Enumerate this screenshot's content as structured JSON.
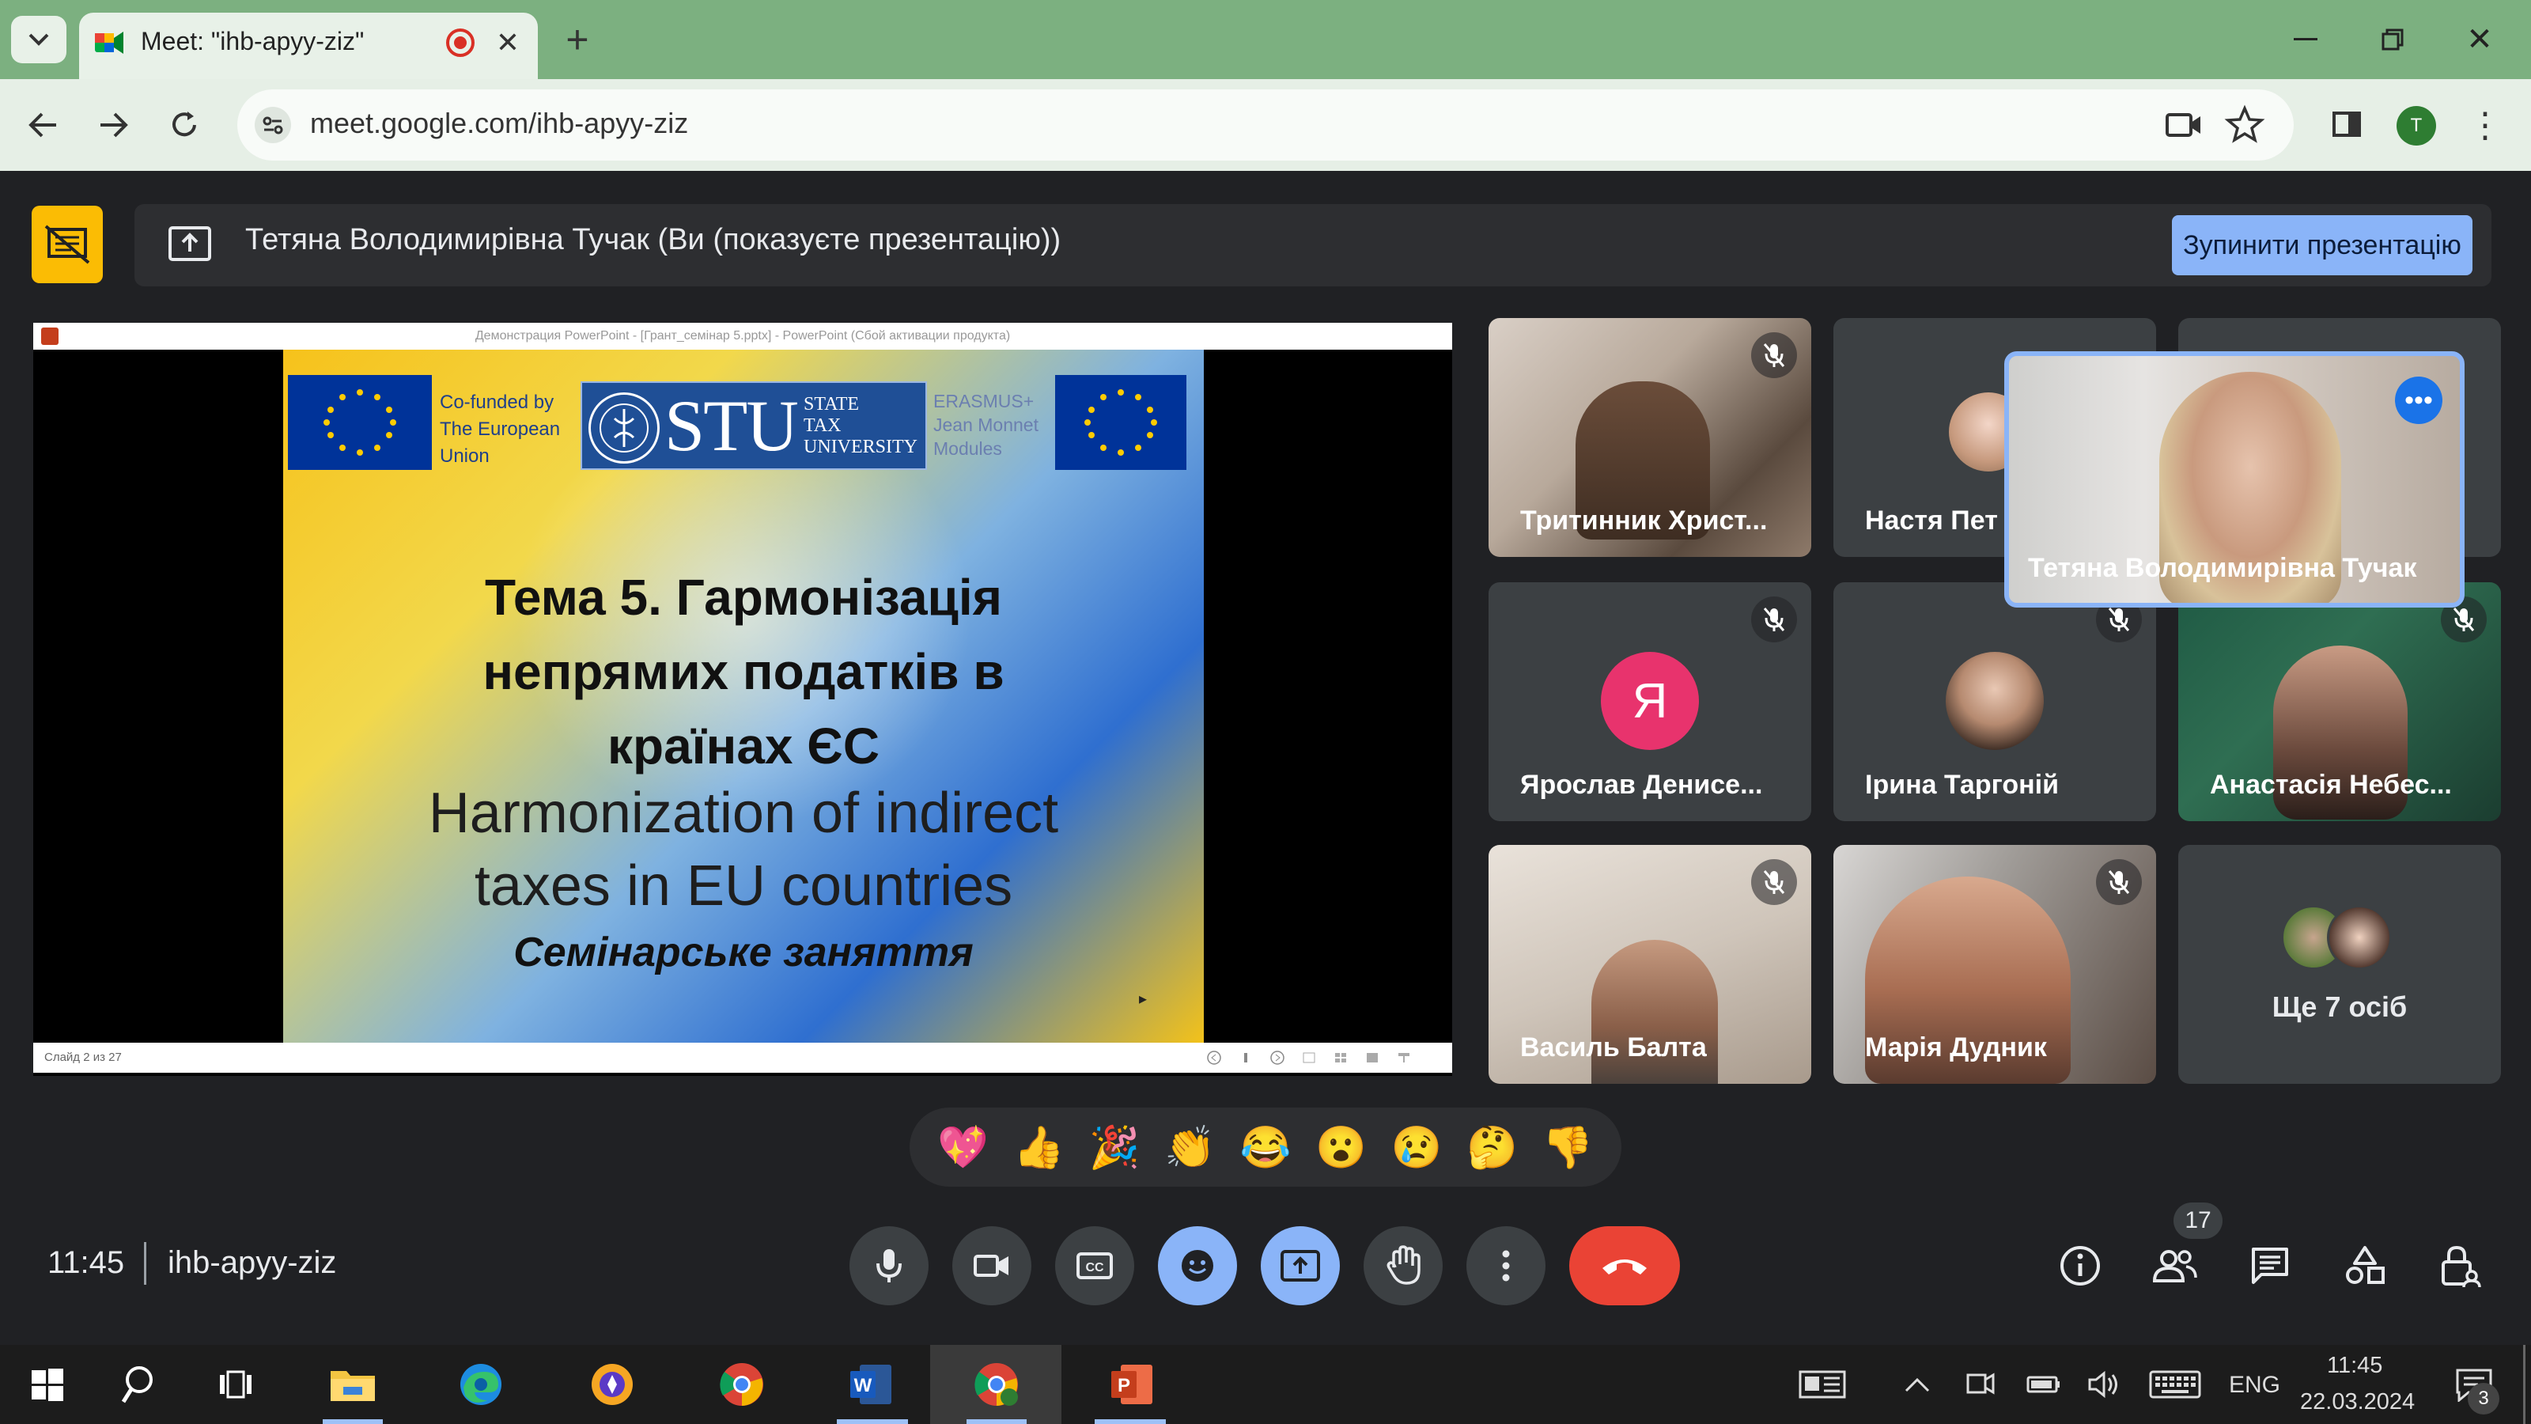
{
  "browser": {
    "tab_title": "Meet: \"ihb-apyy-ziz\"",
    "new_tab": "+",
    "url": "meet.google.com/ihb-apyy-ziz",
    "profile_initial": "T"
  },
  "meet": {
    "present_banner": "Тетяна Володимирівна Тучак (Ви (показуєте презентацію))",
    "stop_presenting": "Зупинити презентацію",
    "time": "11:45",
    "meeting_code": "ihb-apyy-ziz",
    "participant_count": "17",
    "more_people_label": "Ще 7 осіб"
  },
  "presentation": {
    "window_title": "Демонстрация PowerPoint - [Грант_семінар 5.pptx] - PowerPoint (Сбой активации продукта)",
    "status": "Слайд 2 из 27",
    "cofunded": [
      "Co-funded by",
      "The European",
      "Union"
    ],
    "stu_big": "STU",
    "stu_small": [
      "STATE",
      "TAX",
      "UNIVERSITY"
    ],
    "erasmus": [
      "ERASMUS+",
      "Jean Monnet",
      "Modules"
    ],
    "title_lines": [
      "Тема 5. Гармонізація",
      "непрямих податків в",
      "країнах ЄС"
    ],
    "subtitle_lines": [
      "Harmonization of indirect",
      "taxes in EU countries"
    ],
    "seminar": "Семінарське заняття"
  },
  "participants": [
    {
      "name": "Тритинник Христ...",
      "muted": true
    },
    {
      "name": "Настя Пет",
      "muted": false
    },
    {
      "name": "Тетяна Володимирівна Тучак",
      "muted": false
    },
    {
      "name": "Ярослав Денисе...",
      "muted": true,
      "avatar_letter": "Я",
      "avatar_color": "#e8336d"
    },
    {
      "name": "Ірина Таргоній",
      "muted": true
    },
    {
      "name": "Анастасія Небес...",
      "muted": true
    },
    {
      "name": "Василь Балта",
      "muted": true
    },
    {
      "name": "Марія Дудник",
      "muted": true
    }
  ],
  "reactions": [
    "💖",
    "👍",
    "🎉",
    "👏",
    "😂",
    "😮",
    "😢",
    "🤔",
    "👎"
  ],
  "taskbar": {
    "lang": "ENG",
    "time": "11:45",
    "date": "22.03.2024",
    "notifications": "3"
  },
  "colors": {
    "accent_blue": "#8ab4f8",
    "hangup_red": "#ea4335",
    "present_yellow": "#fbbc04",
    "tab_bar_green": "#7cb080"
  }
}
